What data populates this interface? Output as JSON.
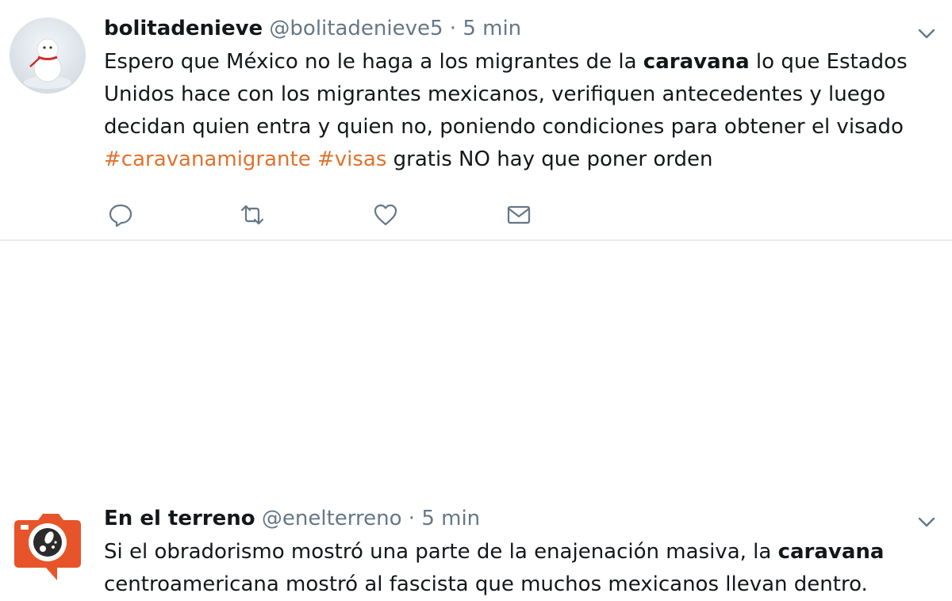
{
  "tweets": [
    {
      "name": "bolitadenieve",
      "handle": "@bolitadenieve5",
      "sep": "·",
      "time": "5 min",
      "text": {
        "p1": "Espero que México no le haga a los migrantes de la ",
        "bold1": "caravana",
        "p2": " lo que Estados Unidos hace con los migrantes mexicanos, verifiquen antecedentes y luego decidan quien entra y quien no, poniendo condiciones para obtener el visado ",
        "tag1": "#caravanamigrante",
        "tag2": "#visas",
        "p3": " gratis NO hay que poner orden"
      },
      "icons": [
        "reply-icon",
        "retweet-icon",
        "like-icon",
        "message-icon"
      ]
    },
    {
      "name": "En el terreno",
      "handle": "@enelterreno",
      "sep": "·",
      "time": "5 min",
      "text": {
        "p1": "Si el obradorismo mostró una parte de la enajenación masiva, la ",
        "bold1": "caravana",
        "p2": " centroamericana mostró al fascista que muchos mexicanos llevan dentro."
      }
    }
  ],
  "colors": {
    "hashtag": "#e0722c",
    "meta": "#657786",
    "divider": "#e6ecf0",
    "avatar2": "#e8542a"
  }
}
